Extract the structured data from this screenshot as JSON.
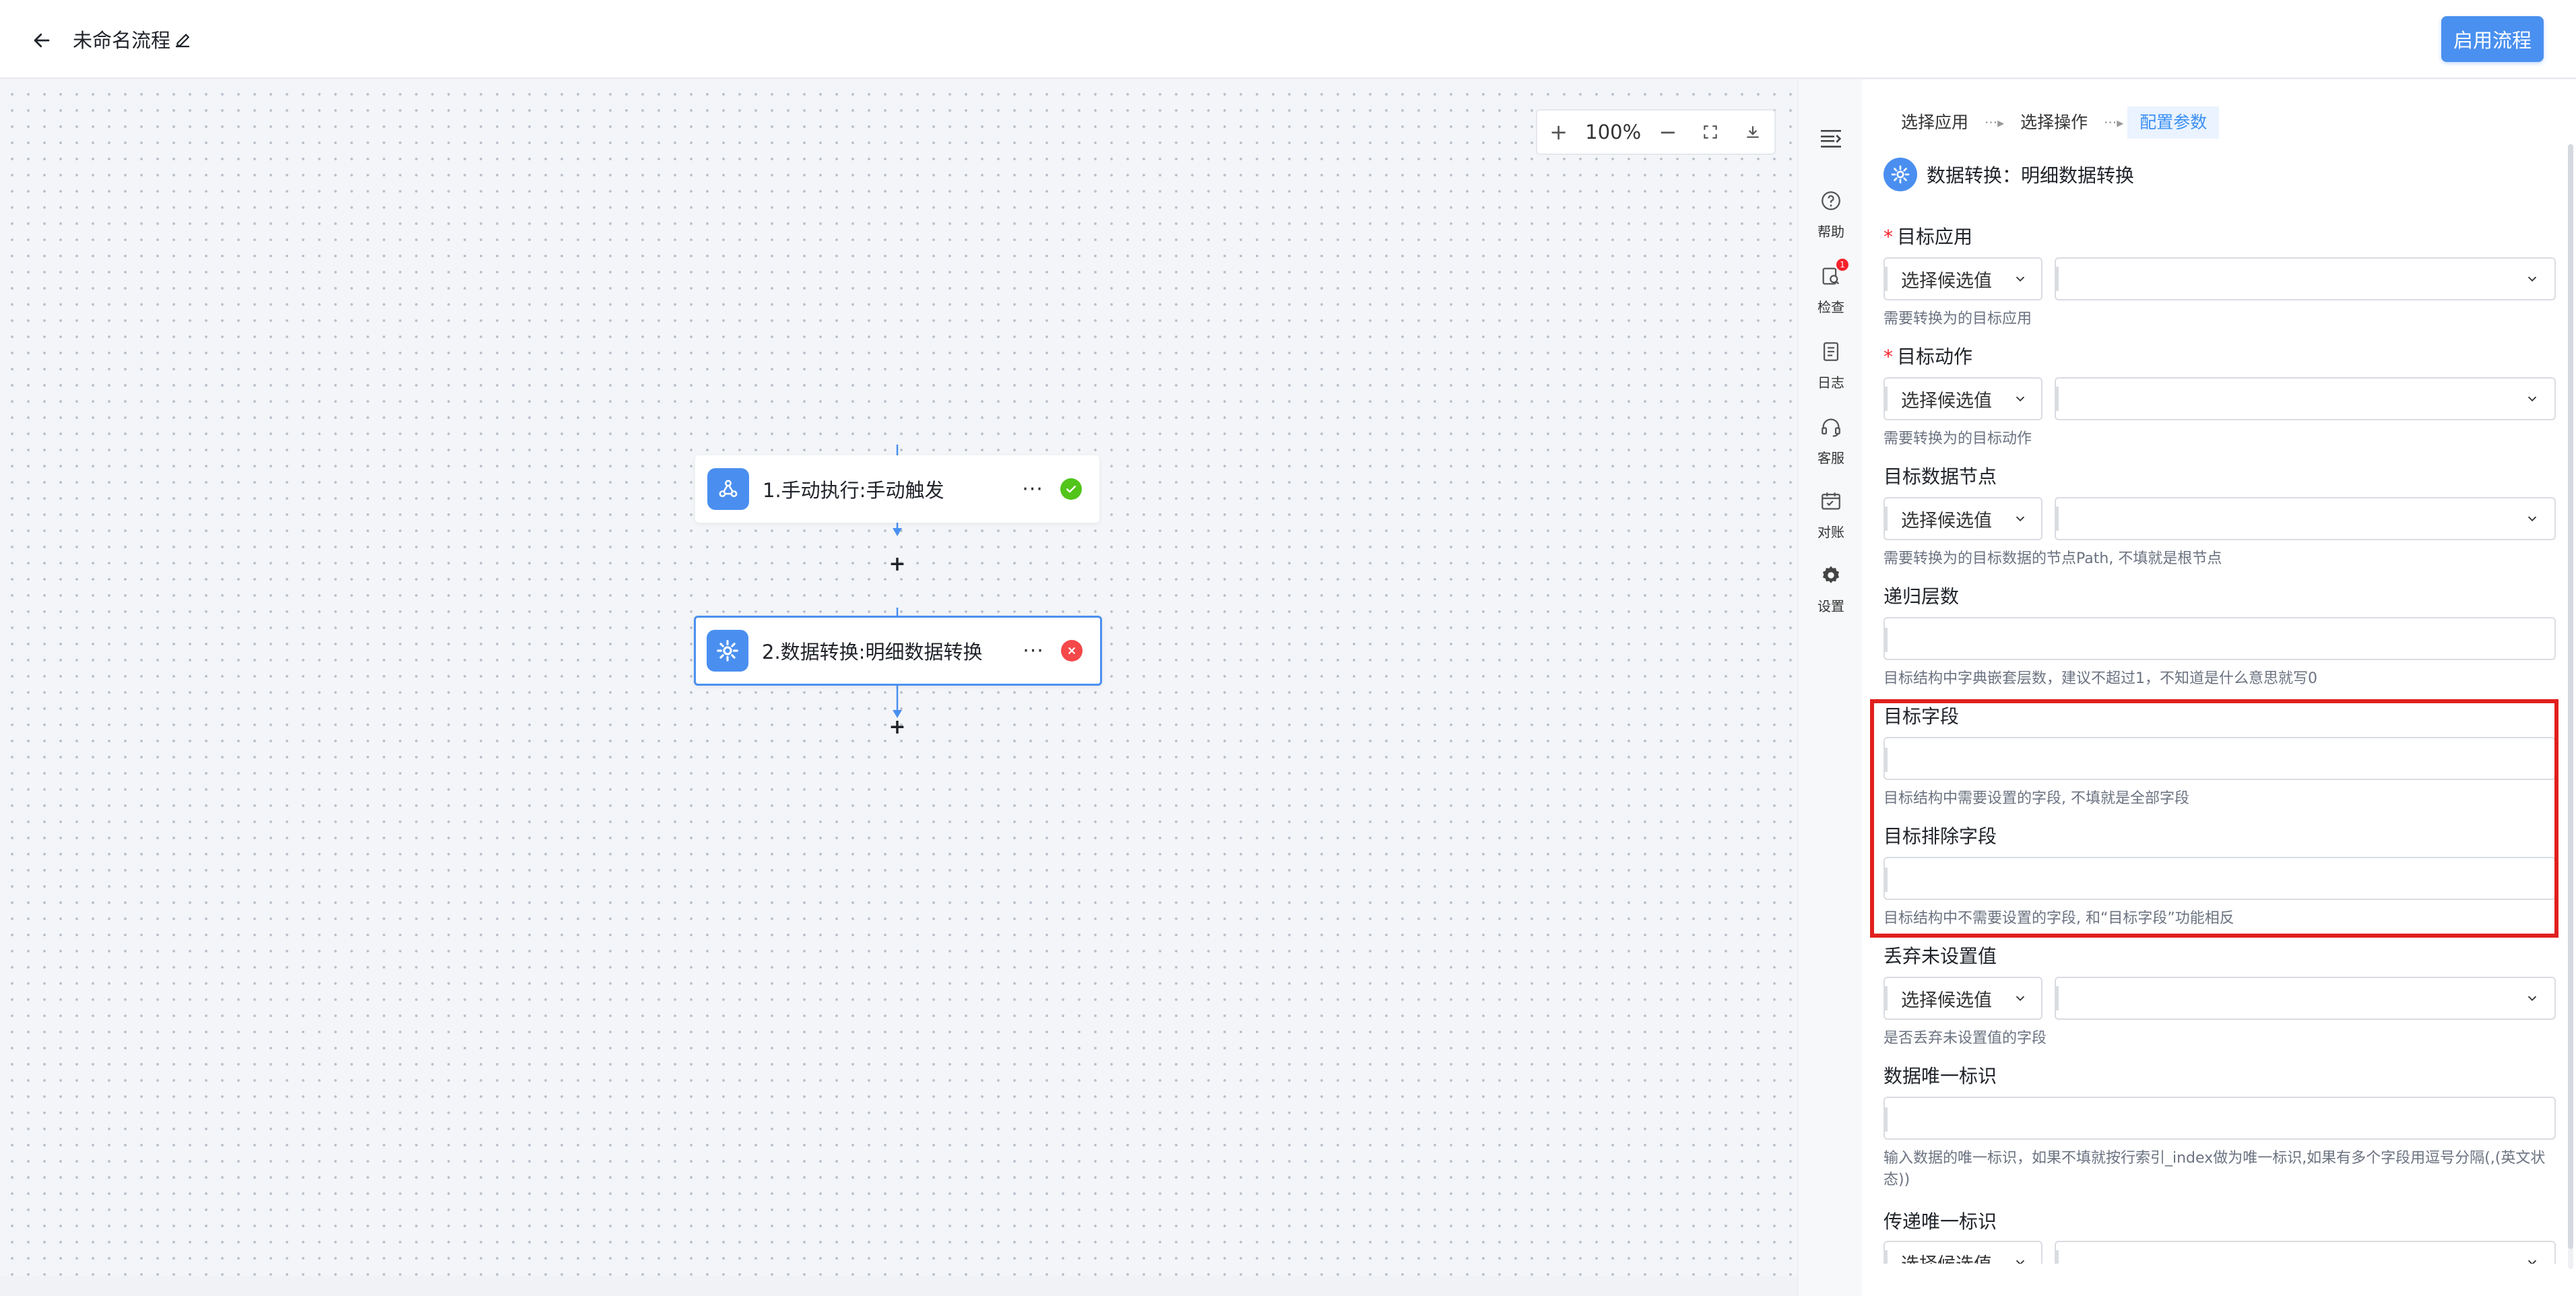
{
  "header": {
    "title": "未命名流程",
    "enable_button": "启用流程"
  },
  "canvas": {
    "zoom_in": "+",
    "zoom_level": "100%",
    "zoom_out": "−",
    "nodes": [
      {
        "label": "1.手动执行:手动触发",
        "more": "···",
        "status": "success"
      },
      {
        "label": "2.数据转换:明细数据转换",
        "more": "···",
        "status": "error"
      }
    ],
    "add_symbol": "+"
  },
  "rail": {
    "items": [
      {
        "label": "帮助",
        "icon": "help-icon"
      },
      {
        "label": "检查",
        "icon": "check-icon",
        "badge": "1"
      },
      {
        "label": "日志",
        "icon": "log-icon"
      },
      {
        "label": "客服",
        "icon": "headset-icon"
      },
      {
        "label": "对账",
        "icon": "reconcile-icon"
      },
      {
        "label": "设置",
        "icon": "gear-icon"
      }
    ]
  },
  "panel": {
    "steps": [
      "选择应用",
      "选择操作",
      "配置参数"
    ],
    "step_separator": "···▸",
    "title": "数据转换：明细数据转换",
    "select_placeholder": "选择候选值",
    "fields": {
      "target_app": {
        "label": "目标应用",
        "help": "需要转换为的目标应用"
      },
      "target_action": {
        "label": "目标动作",
        "help": "需要转换为的目标动作"
      },
      "target_node": {
        "label": "目标数据节点",
        "help": "需要转换为的目标数据的节点Path, 不填就是根节点"
      },
      "recursion": {
        "label": "递归层数",
        "help": "目标结构中字典嵌套层数，建议不超过1，不知道是什么意思就写0"
      },
      "target_fields": {
        "label": "目标字段",
        "help": "目标结构中需要设置的字段, 不填就是全部字段"
      },
      "exclude_fields": {
        "label": "目标排除字段",
        "help": "目标结构中不需要设置的字段, 和“目标字段”功能相反"
      },
      "discard_unset": {
        "label": "丢弃未设置值",
        "help": "是否丢弃未设置值的字段"
      },
      "unique_id": {
        "label": "数据唯一标识",
        "help": "输入数据的唯一标识，如果不填就按行索引_index做为唯一标识,如果有多个字段用逗号分隔(,(英文状态))"
      },
      "pass_unique_id": {
        "label": "传递唯一标识"
      }
    },
    "required_mark": "*"
  },
  "colors": {
    "accent": "#4a90f0",
    "highlight": "#e0201e",
    "success": "#52c41a",
    "error": "#f5484a"
  }
}
